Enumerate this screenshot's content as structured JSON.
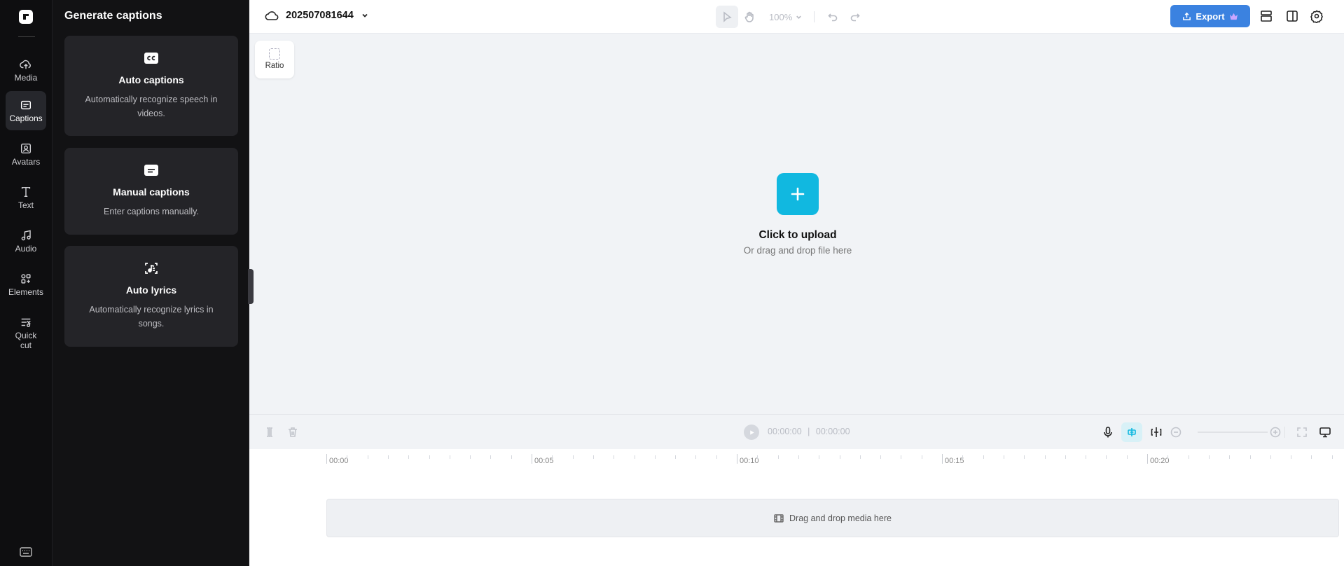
{
  "rail": {
    "items": [
      {
        "label": "Media",
        "icon": "cloud-upload-icon"
      },
      {
        "label": "Captions",
        "icon": "captions-icon",
        "active": true
      },
      {
        "label": "Avatars",
        "icon": "avatar-icon"
      },
      {
        "label": "Text",
        "icon": "text-icon"
      },
      {
        "label": "Audio",
        "icon": "music-note-icon"
      },
      {
        "label": "Elements",
        "icon": "elements-icon"
      },
      {
        "label": "Quick cut",
        "icon": "quick-cut-icon"
      }
    ]
  },
  "panel": {
    "title": "Generate captions",
    "cards": [
      {
        "title": "Auto captions",
        "description": "Automatically recognize speech in videos.",
        "icon": "cc-icon"
      },
      {
        "title": "Manual captions",
        "description": "Enter captions manually.",
        "icon": "keyboard-caption-icon"
      },
      {
        "title": "Auto lyrics",
        "description": "Automatically recognize lyrics in songs.",
        "icon": "lyrics-icon"
      }
    ]
  },
  "topbar": {
    "project_name": "202507081644",
    "zoom": "100%",
    "export_label": "Export"
  },
  "canvas": {
    "ratio_label": "Ratio",
    "upload_title": "Click to upload",
    "upload_subtitle": "Or drag and drop file here"
  },
  "timeline": {
    "current_time": "00:00:00",
    "total_time": "00:00:00",
    "ruler": [
      "00:00",
      "00:05",
      "00:10",
      "00:15",
      "00:20"
    ],
    "drop_text": "Drag and drop media here"
  },
  "colors": {
    "accent": "#11b8e0",
    "export": "#3b82e0",
    "rail_bg": "#0e0e10",
    "panel_bg": "#121214",
    "card_bg": "#242428"
  }
}
